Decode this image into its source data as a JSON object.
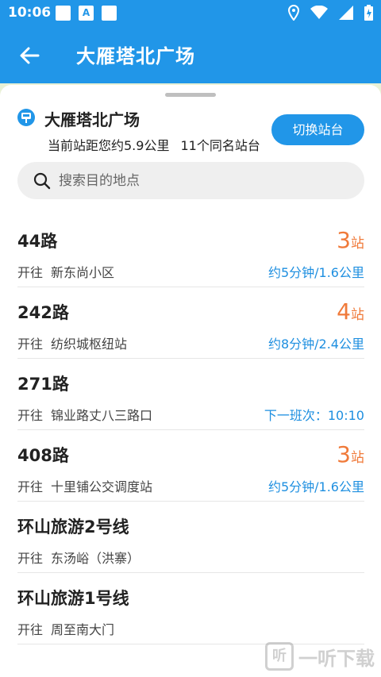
{
  "status_bar": {
    "time": "10:06",
    "notification_letter": "A"
  },
  "app_bar": {
    "title": "大雁塔北广场"
  },
  "station": {
    "name": "大雁塔北广场",
    "distance_text": "当前站距您约5.9公里",
    "same_name_text": "11个同名站台",
    "switch_label": "切换站台"
  },
  "search": {
    "placeholder": "搜索目的地点"
  },
  "routes": [
    {
      "name": "44路",
      "prefix": "开往",
      "destination": "新东尚小区",
      "stops_num": "3",
      "stops_unit": "站",
      "eta": "约5分钟/1.6公里"
    },
    {
      "name": "242路",
      "prefix": "开往",
      "destination": "纺织城枢纽站",
      "stops_num": "4",
      "stops_unit": "站",
      "eta": "约8分钟/2.4公里"
    },
    {
      "name": "271路",
      "prefix": "开往",
      "destination": "锦业路丈八三路口",
      "stops_num": "",
      "stops_unit": "",
      "eta": "下一班次：10:10"
    },
    {
      "name": "408路",
      "prefix": "开往",
      "destination": "十里铺公交调度站",
      "stops_num": "3",
      "stops_unit": "站",
      "eta": "约5分钟/1.6公里"
    },
    {
      "name": "环山旅游2号线",
      "prefix": "开往",
      "destination": "东汤峪（洪寨）",
      "stops_num": "",
      "stops_unit": "",
      "eta": ""
    },
    {
      "name": "环山旅游1号线",
      "prefix": "开往",
      "destination": "周至南大门",
      "stops_num": "",
      "stops_unit": "",
      "eta": ""
    }
  ],
  "watermark": {
    "text": "一听下载"
  },
  "colors": {
    "primary": "#2196e8",
    "stops": "#f07a3a",
    "eta": "#1e8fe0"
  }
}
